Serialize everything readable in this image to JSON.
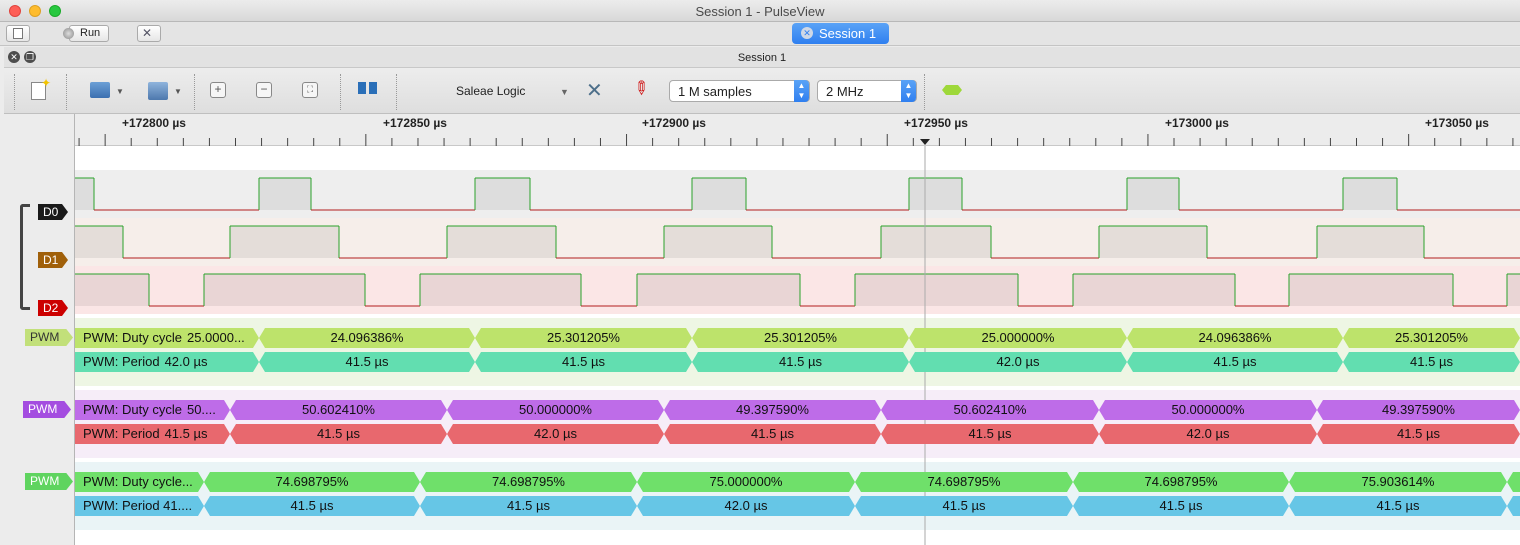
{
  "window": {
    "title": "Session 1 - PulseView"
  },
  "tabbar": {
    "run_label": "Run",
    "session_tab": "Session 1"
  },
  "session": {
    "title": "Session 1"
  },
  "toolbar": {
    "device": "Saleae Logic",
    "samples": "1 M samples",
    "samplerate": "2 MHz"
  },
  "ruler": {
    "ticks": [
      "+172800 µs",
      "+172850 µs",
      "+172900 µs",
      "+172950 µs",
      "+173000 µs",
      "+173050 µs"
    ]
  },
  "channels": [
    {
      "label": "D0",
      "color": "#1a1a1a"
    },
    {
      "label": "D1",
      "color": "#a0600a"
    },
    {
      "label": "D2",
      "color": "#cc0000"
    }
  ],
  "decoders": [
    {
      "label": "PWM",
      "color": "#c2e07a",
      "text_color": "#333",
      "duty_title": "PWM: Duty cycle",
      "duty_first": "25.0000...",
      "duty_values": [
        "24.096386%",
        "25.301205%",
        "25.301205%",
        "25.000000%",
        "24.096386%",
        "25.301205%"
      ],
      "duty_color": "#bde36b",
      "period_title": "PWM: Period",
      "period_first": "42.0 µs",
      "period_values": [
        "41.5 µs",
        "41.5 µs",
        "41.5 µs",
        "42.0 µs",
        "41.5 µs",
        "41.5 µs"
      ],
      "period_color": "#62deb0"
    },
    {
      "label": "PWM",
      "color": "#a44de0",
      "text_color": "#fff",
      "duty_title": "PWM: Duty cycle",
      "duty_first": "50....",
      "duty_values": [
        "50.602410%",
        "50.000000%",
        "49.397590%",
        "50.602410%",
        "50.000000%",
        "49.397590%"
      ],
      "duty_color": "#be6ce8",
      "period_title": "PWM: Period",
      "period_first": "41.5 µs",
      "period_values": [
        "41.5 µs",
        "42.0 µs",
        "41.5 µs",
        "41.5 µs",
        "42.0 µs",
        "41.5 µs"
      ],
      "period_color": "#e8686e"
    },
    {
      "label": "PWM",
      "color": "#5fd45f",
      "text_color": "#fff",
      "duty_title": "PWM: Duty cycle...",
      "duty_first": "",
      "duty_values": [
        "74.698795%",
        "74.698795%",
        "75.000000%",
        "74.698795%",
        "74.698795%",
        "75.903614%"
      ],
      "duty_color": "#6fe06a",
      "period_title": "PWM: Period 41....",
      "period_first": "",
      "period_values": [
        "41.5 µs",
        "41.5 µs",
        "42.0 µs",
        "41.5 µs",
        "41.5 µs",
        "41.5 µs"
      ],
      "period_color": "#66c6e6"
    }
  ]
}
